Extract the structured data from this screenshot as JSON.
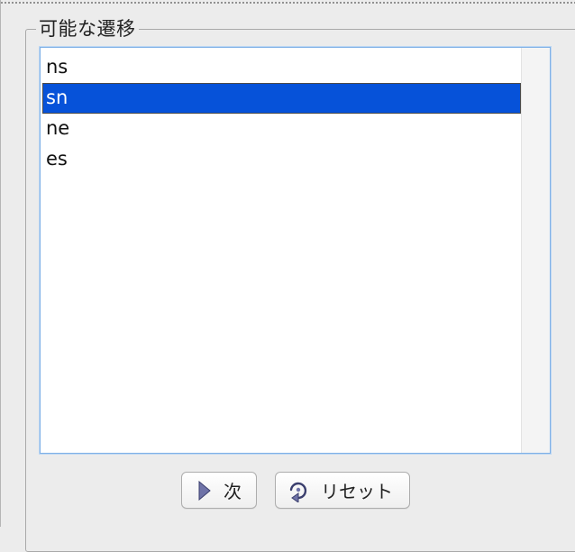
{
  "group": {
    "title": "可能な遷移"
  },
  "transitions": {
    "items": [
      "ns",
      "sn",
      "ne",
      "es"
    ],
    "selected_index": 1
  },
  "buttons": {
    "next_label": "次",
    "next_icon": "play-triangle-icon",
    "reset_label": "リセット",
    "reset_icon": "reset-cycle-icon"
  },
  "colors": {
    "selection": "#0652d9",
    "focus_border": "#7fb0e6"
  }
}
